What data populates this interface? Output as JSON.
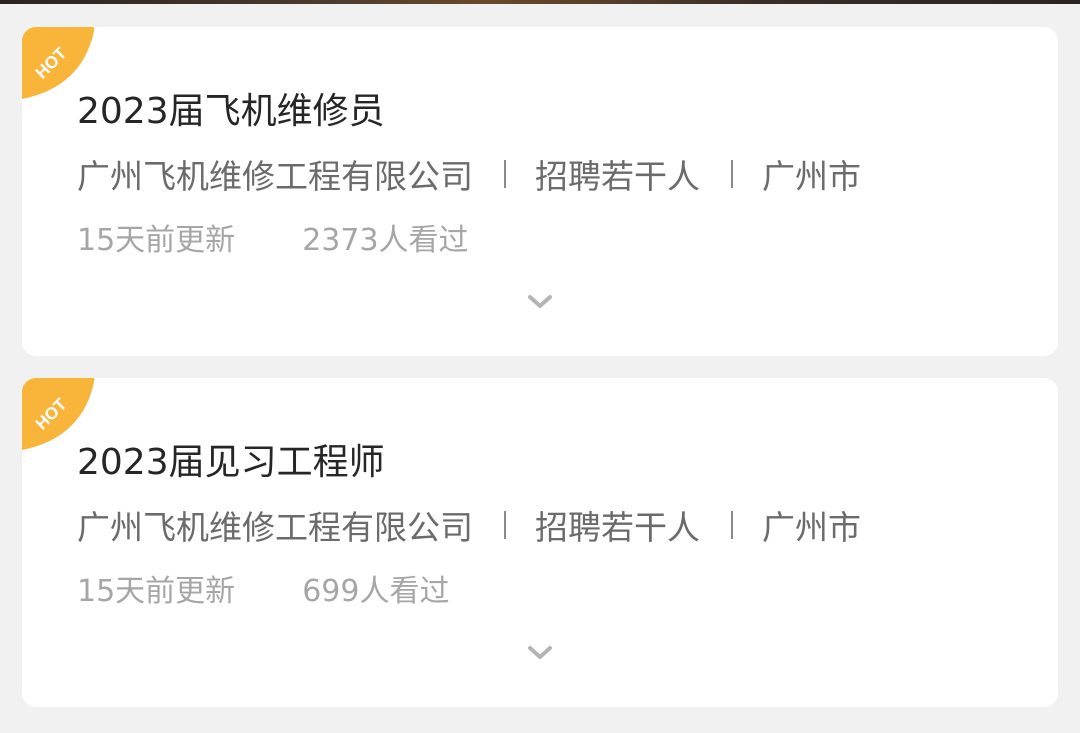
{
  "badge_text": "HOT",
  "badge_color": "#f9b43a",
  "jobs": [
    {
      "title": "2023届飞机维修员",
      "company": "广州飞机维修工程有限公司",
      "headcount": "招聘若干人",
      "city": "广州市",
      "updated": "15天前更新",
      "views": "2373人看过"
    },
    {
      "title": "2023届见习工程师",
      "company": "广州飞机维修工程有限公司",
      "headcount": "招聘若干人",
      "city": "广州市",
      "updated": "15天前更新",
      "views": "699人看过"
    }
  ],
  "icons": {
    "expand": "chevron-down-icon"
  }
}
